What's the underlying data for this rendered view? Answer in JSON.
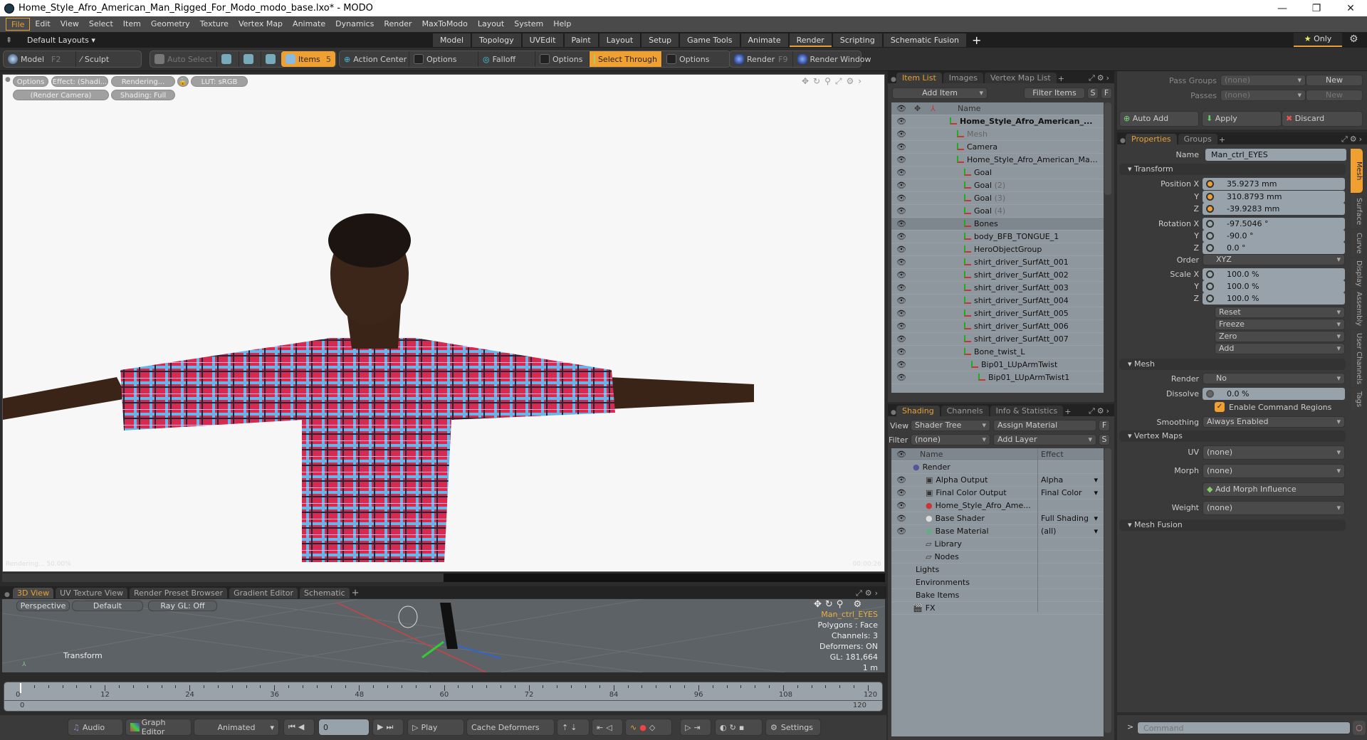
{
  "window": {
    "title": "Home_Style_Afro_American_Man_Rigged_For_Modo_modo_base.lxo* - MODO"
  },
  "menu": [
    "File",
    "Edit",
    "View",
    "Select",
    "Item",
    "Geometry",
    "Texture",
    "Vertex Map",
    "Animate",
    "Dynamics",
    "Render",
    "MaxToModo",
    "Layout",
    "System",
    "Help"
  ],
  "layouts": {
    "selector": "Default Layouts",
    "tabs": [
      "Model",
      "Topology",
      "UVEdit",
      "Paint",
      "Layout",
      "Setup",
      "Game Tools",
      "Animate",
      "Render",
      "Scripting",
      "Schematic Fusion"
    ],
    "active": "Render",
    "only": "Only"
  },
  "toolbar": {
    "model": "Model",
    "model_key": "F2",
    "sculpt": "Sculpt",
    "auto_select": "Auto Select",
    "items": "Items",
    "items_count": "5",
    "action_center": "Action Center",
    "options1": "Options",
    "falloff": "Falloff",
    "options2": "Options",
    "select_through": "Select Through",
    "options3": "Options",
    "render": "Render",
    "render_key": "F9",
    "render_window": "Render Window"
  },
  "render_view": {
    "options": "Options",
    "effect": "Effect: (Shadi...",
    "rendering": "Rendering...",
    "lut": "LUT: sRGB",
    "camera": "(Render Camera)",
    "shading": "Shading: Full",
    "status": "Rendering... 50.00%",
    "time": "00:00:26",
    "progress": 0.5
  },
  "bottom_tabs": [
    "3D View",
    "UV Texture View",
    "Render Preset Browser",
    "Gradient Editor",
    "Schematic"
  ],
  "view3d": {
    "perspective": "Perspective",
    "default": "Default",
    "raygl": "Ray GL: Off",
    "tool": "Transform",
    "info": [
      "Man_ctrl_EYES",
      "Polygons : Face",
      "Channels: 3",
      "Deformers: ON",
      "GL: 181,664",
      "1 m"
    ]
  },
  "timeline": {
    "ticks": [
      "0",
      "12",
      "24",
      "36",
      "48",
      "60",
      "72",
      "84",
      "96",
      "108",
      "120"
    ],
    "start": "0",
    "end": "120",
    "end2": "120"
  },
  "playbar": {
    "audio": "Audio",
    "graph_editor": "Graph Editor",
    "animated": "Animated",
    "frame": "0",
    "play": "Play",
    "cache": "Cache Deformers",
    "settings": "Settings"
  },
  "item_list": {
    "tabs": [
      "Item List",
      "Images",
      "Vertex Map List"
    ],
    "add_item": "Add Item",
    "filter": "Filter Items",
    "s": "S",
    "f": "F",
    "col_name": "Name",
    "rows": [
      {
        "name": "Home_Style_Afro_American_...",
        "indent": 0,
        "bold": true
      },
      {
        "name": "Mesh",
        "indent": 1,
        "dim": true
      },
      {
        "name": "Camera",
        "indent": 1
      },
      {
        "name": "Home_Style_Afro_American_Ma ...",
        "indent": 1
      },
      {
        "name": "Goal",
        "indent": 2
      },
      {
        "name": "Goal",
        "suffix": "(2)",
        "indent": 2
      },
      {
        "name": "Goal",
        "suffix": "(3)",
        "indent": 2
      },
      {
        "name": "Goal",
        "suffix": "(4)",
        "indent": 2
      },
      {
        "name": "Bones",
        "indent": 2,
        "sel": true
      },
      {
        "name": "body_BFB_TONGUE_1",
        "indent": 2
      },
      {
        "name": "HeroObjectGroup",
        "indent": 2
      },
      {
        "name": "shirt_driver_SurfAtt_001",
        "indent": 2
      },
      {
        "name": "shirt_driver_SurfAtt_002",
        "indent": 2
      },
      {
        "name": "shirt_driver_SurfAtt_003",
        "indent": 2
      },
      {
        "name": "shirt_driver_SurfAtt_004",
        "indent": 2
      },
      {
        "name": "shirt_driver_SurfAtt_005",
        "indent": 2
      },
      {
        "name": "shirt_driver_SurfAtt_006",
        "indent": 2
      },
      {
        "name": "shirt_driver_SurfAtt_007",
        "indent": 2
      },
      {
        "name": "Bone_twist_L",
        "indent": 2
      },
      {
        "name": "Bip01_LUpArmTwist",
        "indent": 3
      },
      {
        "name": "Bip01_LUpArmTwist1",
        "indent": 4
      }
    ]
  },
  "shading": {
    "tabs": [
      "Shading",
      "Channels",
      "Info & Statistics"
    ],
    "view_label": "View",
    "view": "Shader Tree",
    "assign": "Assign Material",
    "f": "F",
    "filter_label": "Filter",
    "filter": "(none)",
    "add_layer": "Add Layer",
    "s": "S",
    "col_name": "Name",
    "col_effect": "Effect",
    "rows": [
      {
        "name": "Render",
        "effect": "",
        "indent": 0,
        "eye": false
      },
      {
        "name": "Alpha Output",
        "effect": "Alpha",
        "indent": 1,
        "eye": true
      },
      {
        "name": "Final Color Output",
        "effect": "Final Color",
        "indent": 1,
        "eye": true
      },
      {
        "name": "Home_Style_Afro_Ame...",
        "effect": "",
        "indent": 1,
        "eye": true
      },
      {
        "name": "Base Shader",
        "effect": "Full Shading",
        "indent": 1,
        "eye": true
      },
      {
        "name": "Base Material",
        "effect": "(all)",
        "indent": 1,
        "eye": true
      },
      {
        "name": "Library",
        "effect": "",
        "indent": 1,
        "eye": false
      },
      {
        "name": "Nodes",
        "effect": "",
        "indent": 1,
        "eye": false
      },
      {
        "name": "Lights",
        "effect": "",
        "indent": 0,
        "eye": false
      },
      {
        "name": "Environments",
        "effect": "",
        "indent": 0,
        "eye": false
      },
      {
        "name": "Bake Items",
        "effect": "",
        "indent": 0,
        "eye": false
      },
      {
        "name": "FX",
        "effect": "",
        "indent": 0,
        "eye": false
      }
    ]
  },
  "passes": {
    "pass_groups_label": "Pass Groups",
    "pass_groups": "(none)",
    "passes_label": "Passes",
    "passes": "(none)",
    "new": "New",
    "auto_add": "Auto Add",
    "apply": "Apply",
    "discard": "Discard"
  },
  "properties": {
    "tabs": [
      "Properties",
      "Groups"
    ],
    "side_tabs": [
      "Mesh",
      "Surface",
      "Curve",
      "Display",
      "Assembly",
      "User Channels",
      "Tags"
    ],
    "name_label": "Name",
    "name": "Man_ctrl_EYES",
    "transform": "Transform",
    "position": {
      "label": "Position X",
      "x": "35.9273 mm",
      "y": "310.8793 mm",
      "z": "-39.9283 mm"
    },
    "rotation": {
      "label": "Rotation X",
      "x": "-97.5046 °",
      "y": "-90.0 °",
      "z": "0.0 °"
    },
    "order_label": "Order",
    "order": "XYZ",
    "scale": {
      "label": "Scale X",
      "x": "100.0 %",
      "y": "100.0 %",
      "z": "100.0 %"
    },
    "actions": [
      "Reset",
      "Freeze",
      "Zero",
      "Add"
    ],
    "mesh": "Mesh",
    "render_label": "Render",
    "render": "No",
    "dissolve_label": "Dissolve",
    "dissolve": "0.0 %",
    "command_regions": "Enable Command Regions",
    "smoothing_label": "Smoothing",
    "smoothing": "Always Enabled",
    "vertex_maps": "Vertex Maps",
    "uv_label": "UV",
    "uv": "(none)",
    "morph_label": "Morph",
    "morph": "(none)",
    "add_morph": "Add Morph Influence",
    "weight_label": "Weight",
    "weight": "(none)",
    "mesh_fusion": "Mesh Fusion"
  },
  "command": {
    "placeholder": "Command"
  }
}
